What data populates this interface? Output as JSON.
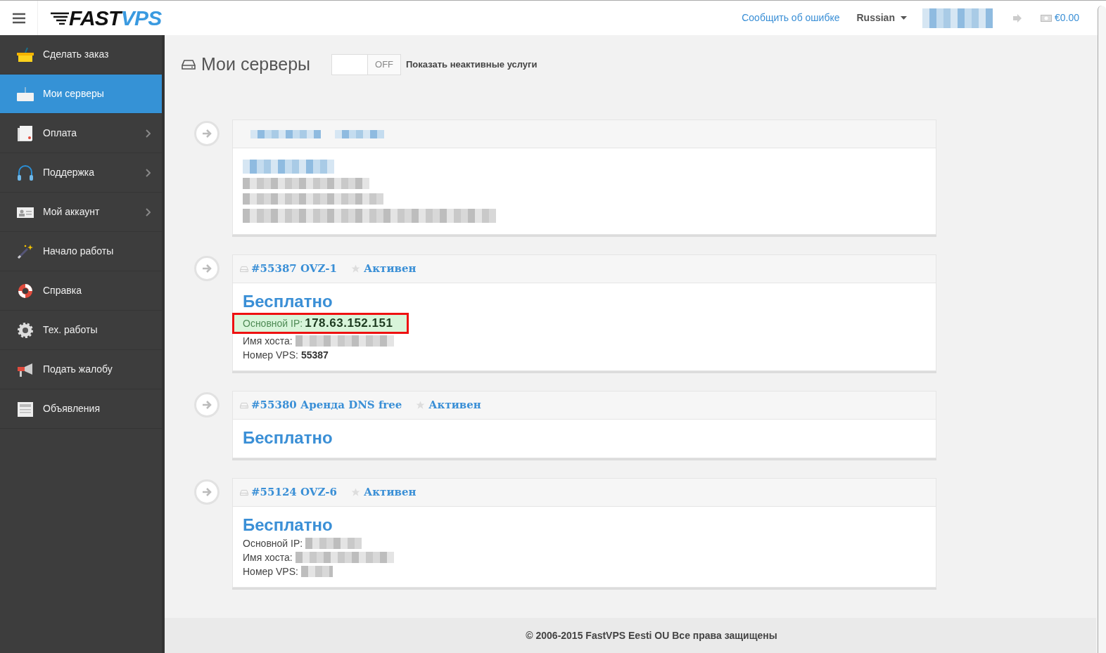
{
  "header": {
    "logo": {
      "part_1": "FAST",
      "part_2": "VPS"
    },
    "report_link": "Сообщить об ошибке",
    "language": "Russian",
    "balance": "€0.00"
  },
  "sidebar": {
    "items": [
      {
        "label": "Сделать заказ",
        "selected": false,
        "submenu": false
      },
      {
        "label": "Мои серверы",
        "selected": true,
        "submenu": false
      },
      {
        "label": "Оплата",
        "selected": false,
        "submenu": true
      },
      {
        "label": "Поддержка",
        "selected": false,
        "submenu": true
      },
      {
        "label": "Мой аккаунт",
        "selected": false,
        "submenu": true
      },
      {
        "label": "Начало работы",
        "selected": false,
        "submenu": false
      },
      {
        "label": "Справка",
        "selected": false,
        "submenu": false
      },
      {
        "label": "Тех. работы",
        "selected": false,
        "submenu": false
      },
      {
        "label": "Подать жалобу",
        "selected": false,
        "submenu": false
      },
      {
        "label": "Объявления",
        "selected": false,
        "submenu": false
      }
    ]
  },
  "page": {
    "title": "Мои серверы",
    "toggle": {
      "label": "OFF",
      "on": false
    },
    "toggle_caption": "Показать неактивные услуги"
  },
  "services": [
    {
      "kind": "redacted"
    },
    {
      "kind": "service",
      "title": "#55387 OVZ-1",
      "status": "Активен",
      "price": "Бесплатно",
      "fields": [
        {
          "label": "Основной IP:",
          "value": "178.63.152.151",
          "highlighted": true
        },
        {
          "label": "Имя хоста:",
          "highlighted": false
        },
        {
          "label": "Номер VPS:",
          "value": "55387",
          "highlighted": false
        }
      ]
    },
    {
      "kind": "service",
      "title": "#55380 Аренда DNS free",
      "status": "Активен",
      "price": "Бесплатно"
    },
    {
      "kind": "service",
      "title": "#55124 OVZ-6",
      "status": "Активен",
      "price": "Бесплатно",
      "fields": [
        {
          "label": "Основной IP:",
          "highlighted": false
        },
        {
          "label": "Имя хоста:",
          "highlighted": false
        },
        {
          "label": "Номер VPS:",
          "highlighted": false
        }
      ]
    }
  ],
  "footer": "© 2006-2015 FastVPS Eesti OU Все права защищены"
}
